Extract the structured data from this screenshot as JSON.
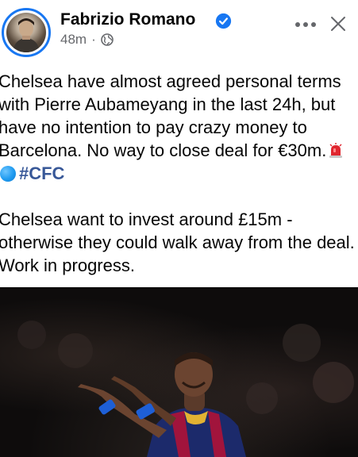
{
  "post": {
    "author": "Fabrizio Romano",
    "time": "48m",
    "separator": "·",
    "paragraph1_text": "Chelsea have almost agreed personal terms with Pierre Aubameyang in the last 24h, but have no intention to pay crazy money to Barcelona. No way to close deal for €30m.",
    "hashtag": "#CFC",
    "paragraph2_text": "Chelsea want to invest around £15m - otherwise they could walk away from the deal. Work in progress."
  },
  "icons": {
    "verified": "verified-badge-icon",
    "audience": "globe-icon",
    "more": "more-options-icon",
    "close": "close-icon",
    "siren": "police-light-emoji",
    "dot": "blue-circle-emoji"
  },
  "colors": {
    "accent": "#1877f2",
    "text": "#050505",
    "muted": "#65676b",
    "hashtag": "#385898"
  }
}
